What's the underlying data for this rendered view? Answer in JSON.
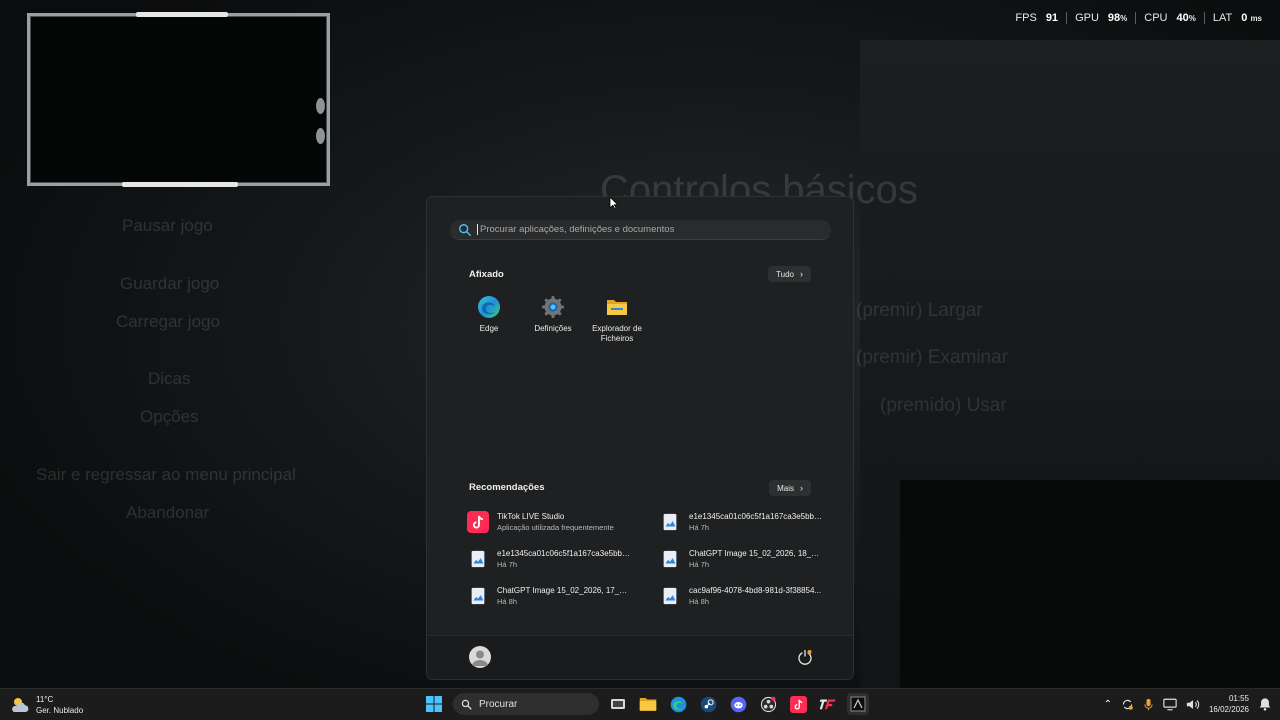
{
  "hud": {
    "fps_label": "FPS",
    "fps_value": "91",
    "gpu_label": "GPU",
    "gpu_value": "98",
    "gpu_unit": "%",
    "cpu_label": "CPU",
    "cpu_value": "40",
    "cpu_unit": "%",
    "lat_label": "LAT",
    "lat_value": "0",
    "lat_unit": "ms"
  },
  "background": {
    "title": "Controlos básicos",
    "menu": [
      "Pausar jogo",
      "Guardar jogo",
      "Carregar jogo",
      "Dicas",
      "Opções",
      "Sair e regressar ao menu principal",
      "Abandonar"
    ],
    "right_lines": [
      "(premir) Largar",
      "(premir) Examinar",
      "(premido) Usar"
    ]
  },
  "start_menu": {
    "search": {
      "placeholder": "Procurar aplicações, definições e documentos"
    },
    "pinned": {
      "title": "Afixado",
      "all_button": "Tudo",
      "apps": [
        {
          "label": "Edge",
          "icon": "edge-icon"
        },
        {
          "label": "Definições",
          "icon": "settings-gear-icon"
        },
        {
          "label": "Explorador de Ficheiros",
          "icon": "folder-icon"
        }
      ]
    },
    "recommended": {
      "title": "Recomendações",
      "more_button": "Mais",
      "items": [
        {
          "name": "TikTok LIVE Studio",
          "sub": "Aplicação utilizada frequentemente",
          "icon": "tiktok-icon"
        },
        {
          "name": "e1e1345ca01c06c5f1a167ca3e5bb8b...",
          "sub": "Há 7h",
          "icon": "image-file-icon"
        },
        {
          "name": "e1e1345ca01c06c5f1a167ca3e5bb8b1",
          "sub": "Há 7h",
          "icon": "image-file-icon"
        },
        {
          "name": "ChatGPT Image 15_02_2026, 18_00_...",
          "sub": "Há 7h",
          "icon": "image-file-icon"
        },
        {
          "name": "ChatGPT Image 15_02_2026, 17_28_...",
          "sub": "Há 8h",
          "icon": "image-file-icon"
        },
        {
          "name": "cac9af96-4078-4bd8-981d-3f38854...",
          "sub": "Há 8h",
          "icon": "image-file-icon"
        }
      ]
    }
  },
  "taskbar": {
    "weather": {
      "temp": "11°C",
      "condition": "Ger. Nublado"
    },
    "search_label": "Procurar",
    "time": "01:55",
    "date": "16/02/2026"
  },
  "colors": {
    "accent_blue": "#4cc2ff",
    "tiktok_pink": "#fe2c55",
    "folder_yellow": "#f7c843"
  }
}
